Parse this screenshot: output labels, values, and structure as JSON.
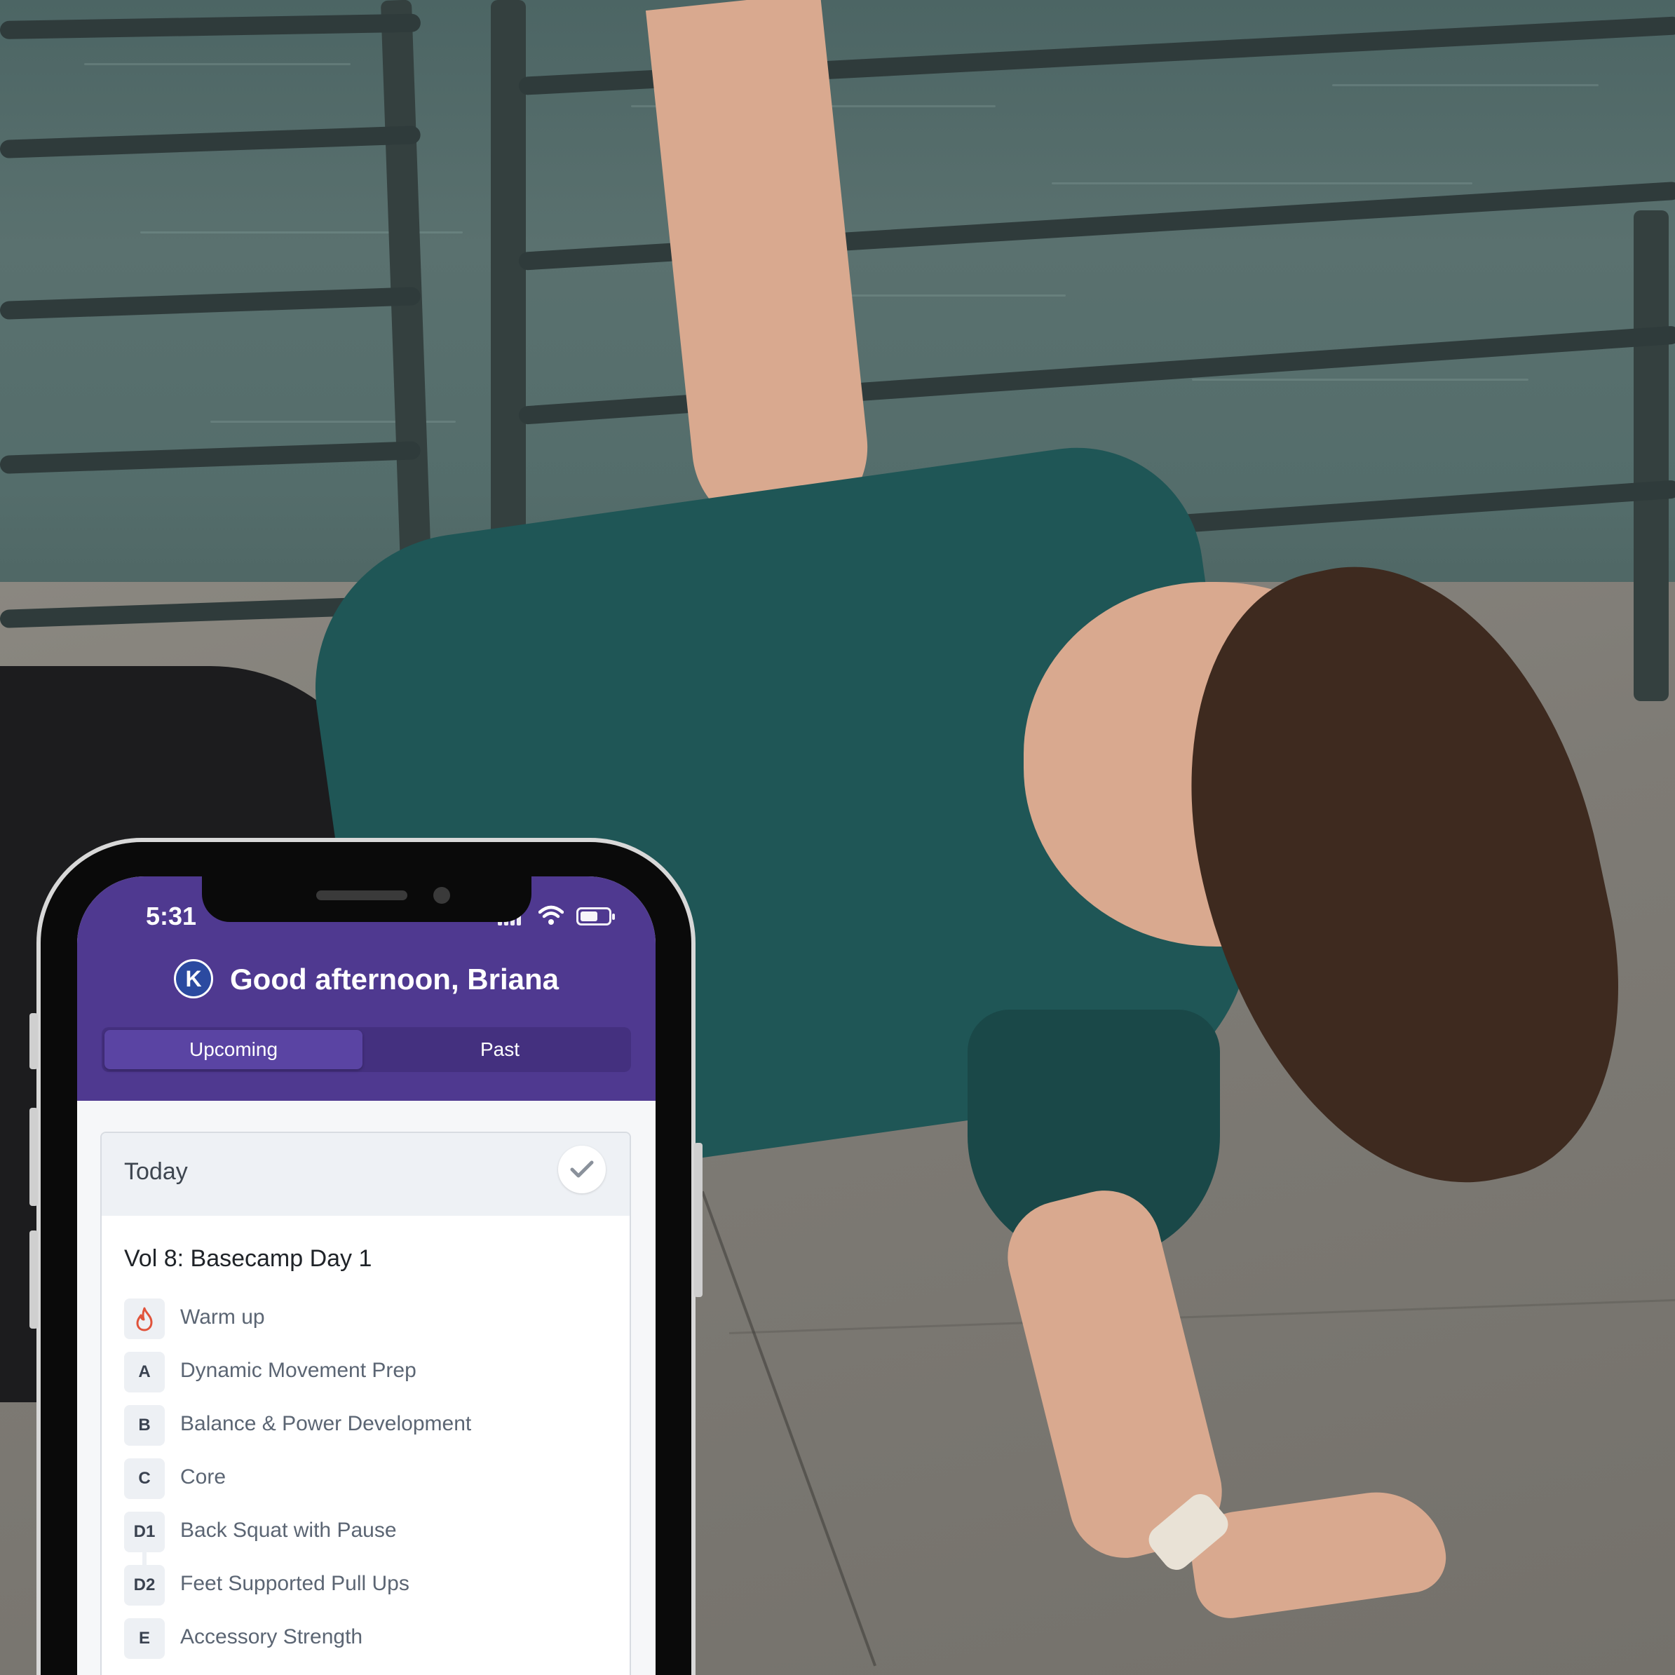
{
  "status_bar": {
    "time": "5:31"
  },
  "brand": {
    "logo_letter": "K"
  },
  "header": {
    "greeting": "Good afternoon, Briana"
  },
  "tabs": [
    {
      "label": "Upcoming",
      "active": true
    },
    {
      "label": "Past",
      "active": false
    }
  ],
  "card": {
    "title": "Today",
    "workout_title": "Vol 8: Basecamp Day 1",
    "items": [
      {
        "badge": "",
        "icon": "flame-icon",
        "label": "Warm up"
      },
      {
        "badge": "A",
        "label": "Dynamic Movement Prep"
      },
      {
        "badge": "B",
        "label": "Balance & Power Development"
      },
      {
        "badge": "C",
        "label": "Core"
      },
      {
        "badge": "D1",
        "label": "Back Squat with Pause"
      },
      {
        "badge": "D2",
        "label": "Feet Supported Pull Ups"
      },
      {
        "badge": "E",
        "label": "Accessory Strength"
      }
    ]
  },
  "colors": {
    "header_purple": "#4f3990",
    "flame_red": "#e0533b"
  }
}
